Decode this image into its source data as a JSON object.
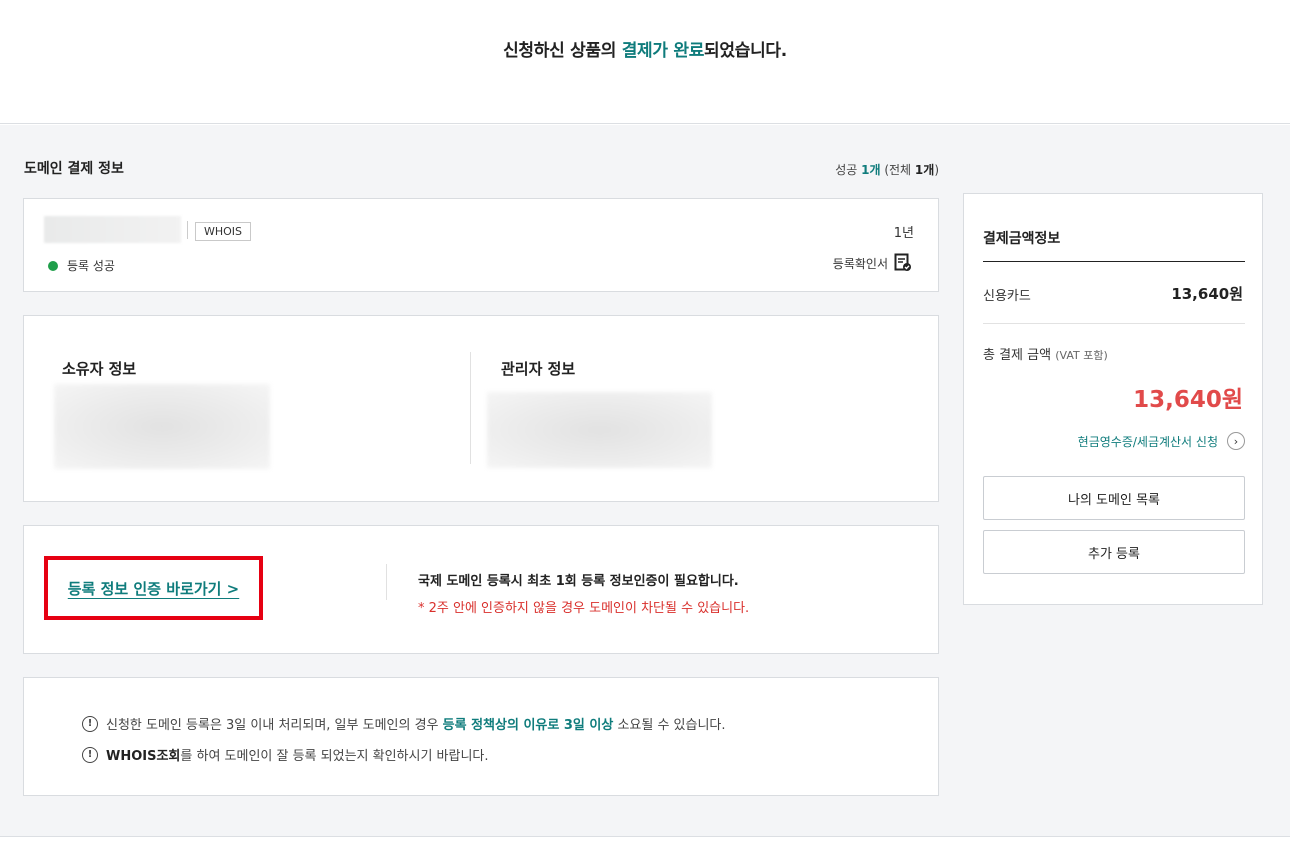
{
  "header": {
    "title_pre": "신청하신 상품의 ",
    "title_accent": "결제가 완료",
    "title_post": "되었습니다."
  },
  "domain_section": {
    "title": "도메인 결제 정보",
    "count_prefix": "성공 ",
    "count_success": "1개",
    "count_mid": " (전체 ",
    "count_total": "1개",
    "count_suffix": ")"
  },
  "domain_item": {
    "whois_label": "WHOIS",
    "status": "등록 성공",
    "status_color": "#1f9e4a",
    "period": "1년",
    "certificate_label": "등록확인서"
  },
  "contacts": {
    "owner_title": "소유자 정보",
    "admin_title": "관리자 정보"
  },
  "verification": {
    "link_label": "등록 정보 인증 바로가기 >",
    "main_text": "국제 도메인 등록시 최초 1회 등록 정보인증이 필요합니다.",
    "warning_text": "* 2주 안에 인증하지 않을 경우 도메인이 차단될 수 있습니다.",
    "highlight_color": "#e60012"
  },
  "notices": {
    "n1_pre": "신청한 도메인 등록은 3일 이내 처리되며, 일부 도메인의 경우 ",
    "n1_accent": "등록 정책상의 이유로 3일 이상",
    "n1_post": " 소요될 수 있습니다.",
    "n2_bold": "WHOIS조회",
    "n2_post": "를 하여 도메인이 잘 등록 되었는지 확인하시기 바랍니다."
  },
  "payment": {
    "title": "결제금액정보",
    "method_label": "신용카드",
    "method_amount": "13,640원",
    "total_label": "총 결제 금액",
    "total_note": "(VAT 포함)",
    "total_amount": "13,640원",
    "receipt_link": "현금영수증/세금계산서 신청",
    "btn_my_domains": "나의 도메인 목록",
    "btn_add": "추가 등록"
  },
  "colors": {
    "accent": "#0f7c7c",
    "total": "#e14a4a",
    "warning": "#d9302c"
  }
}
